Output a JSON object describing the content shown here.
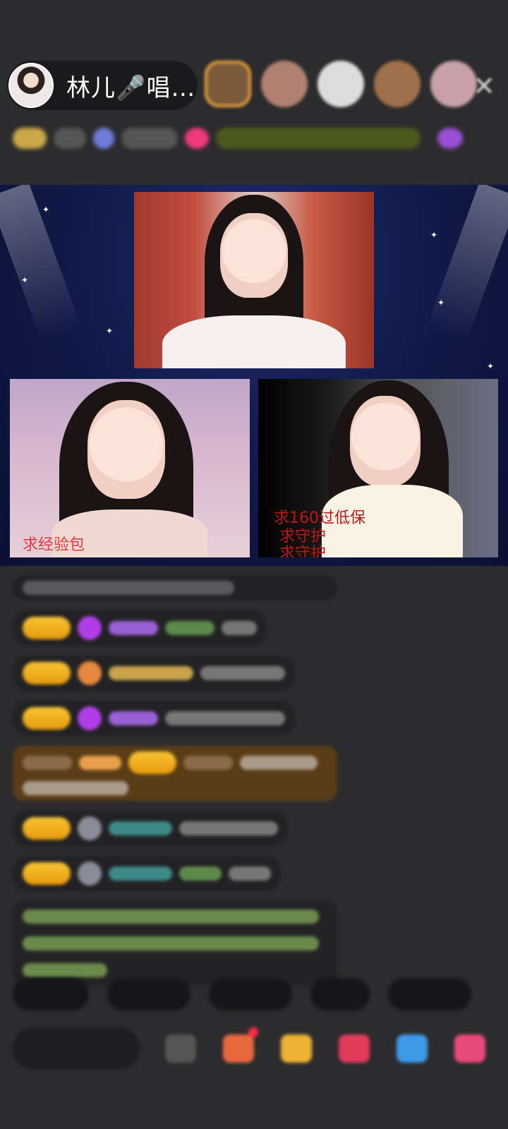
{
  "header": {
    "host_name": "林儿🎤唱…"
  },
  "stage": {
    "left_cam_label": "求经验包",
    "right_cam_text_lines": [
      "求160过低保",
      "求守护",
      "求守护"
    ]
  },
  "colors": {
    "background": "#2c2c2e",
    "badge_gold": "#f8c434",
    "stage_blue": "#101845",
    "alert_red": "#e13b3b"
  },
  "icons": [
    "close-icon",
    "mic-icon",
    "gift-icon",
    "share-icon",
    "more-icon"
  ]
}
